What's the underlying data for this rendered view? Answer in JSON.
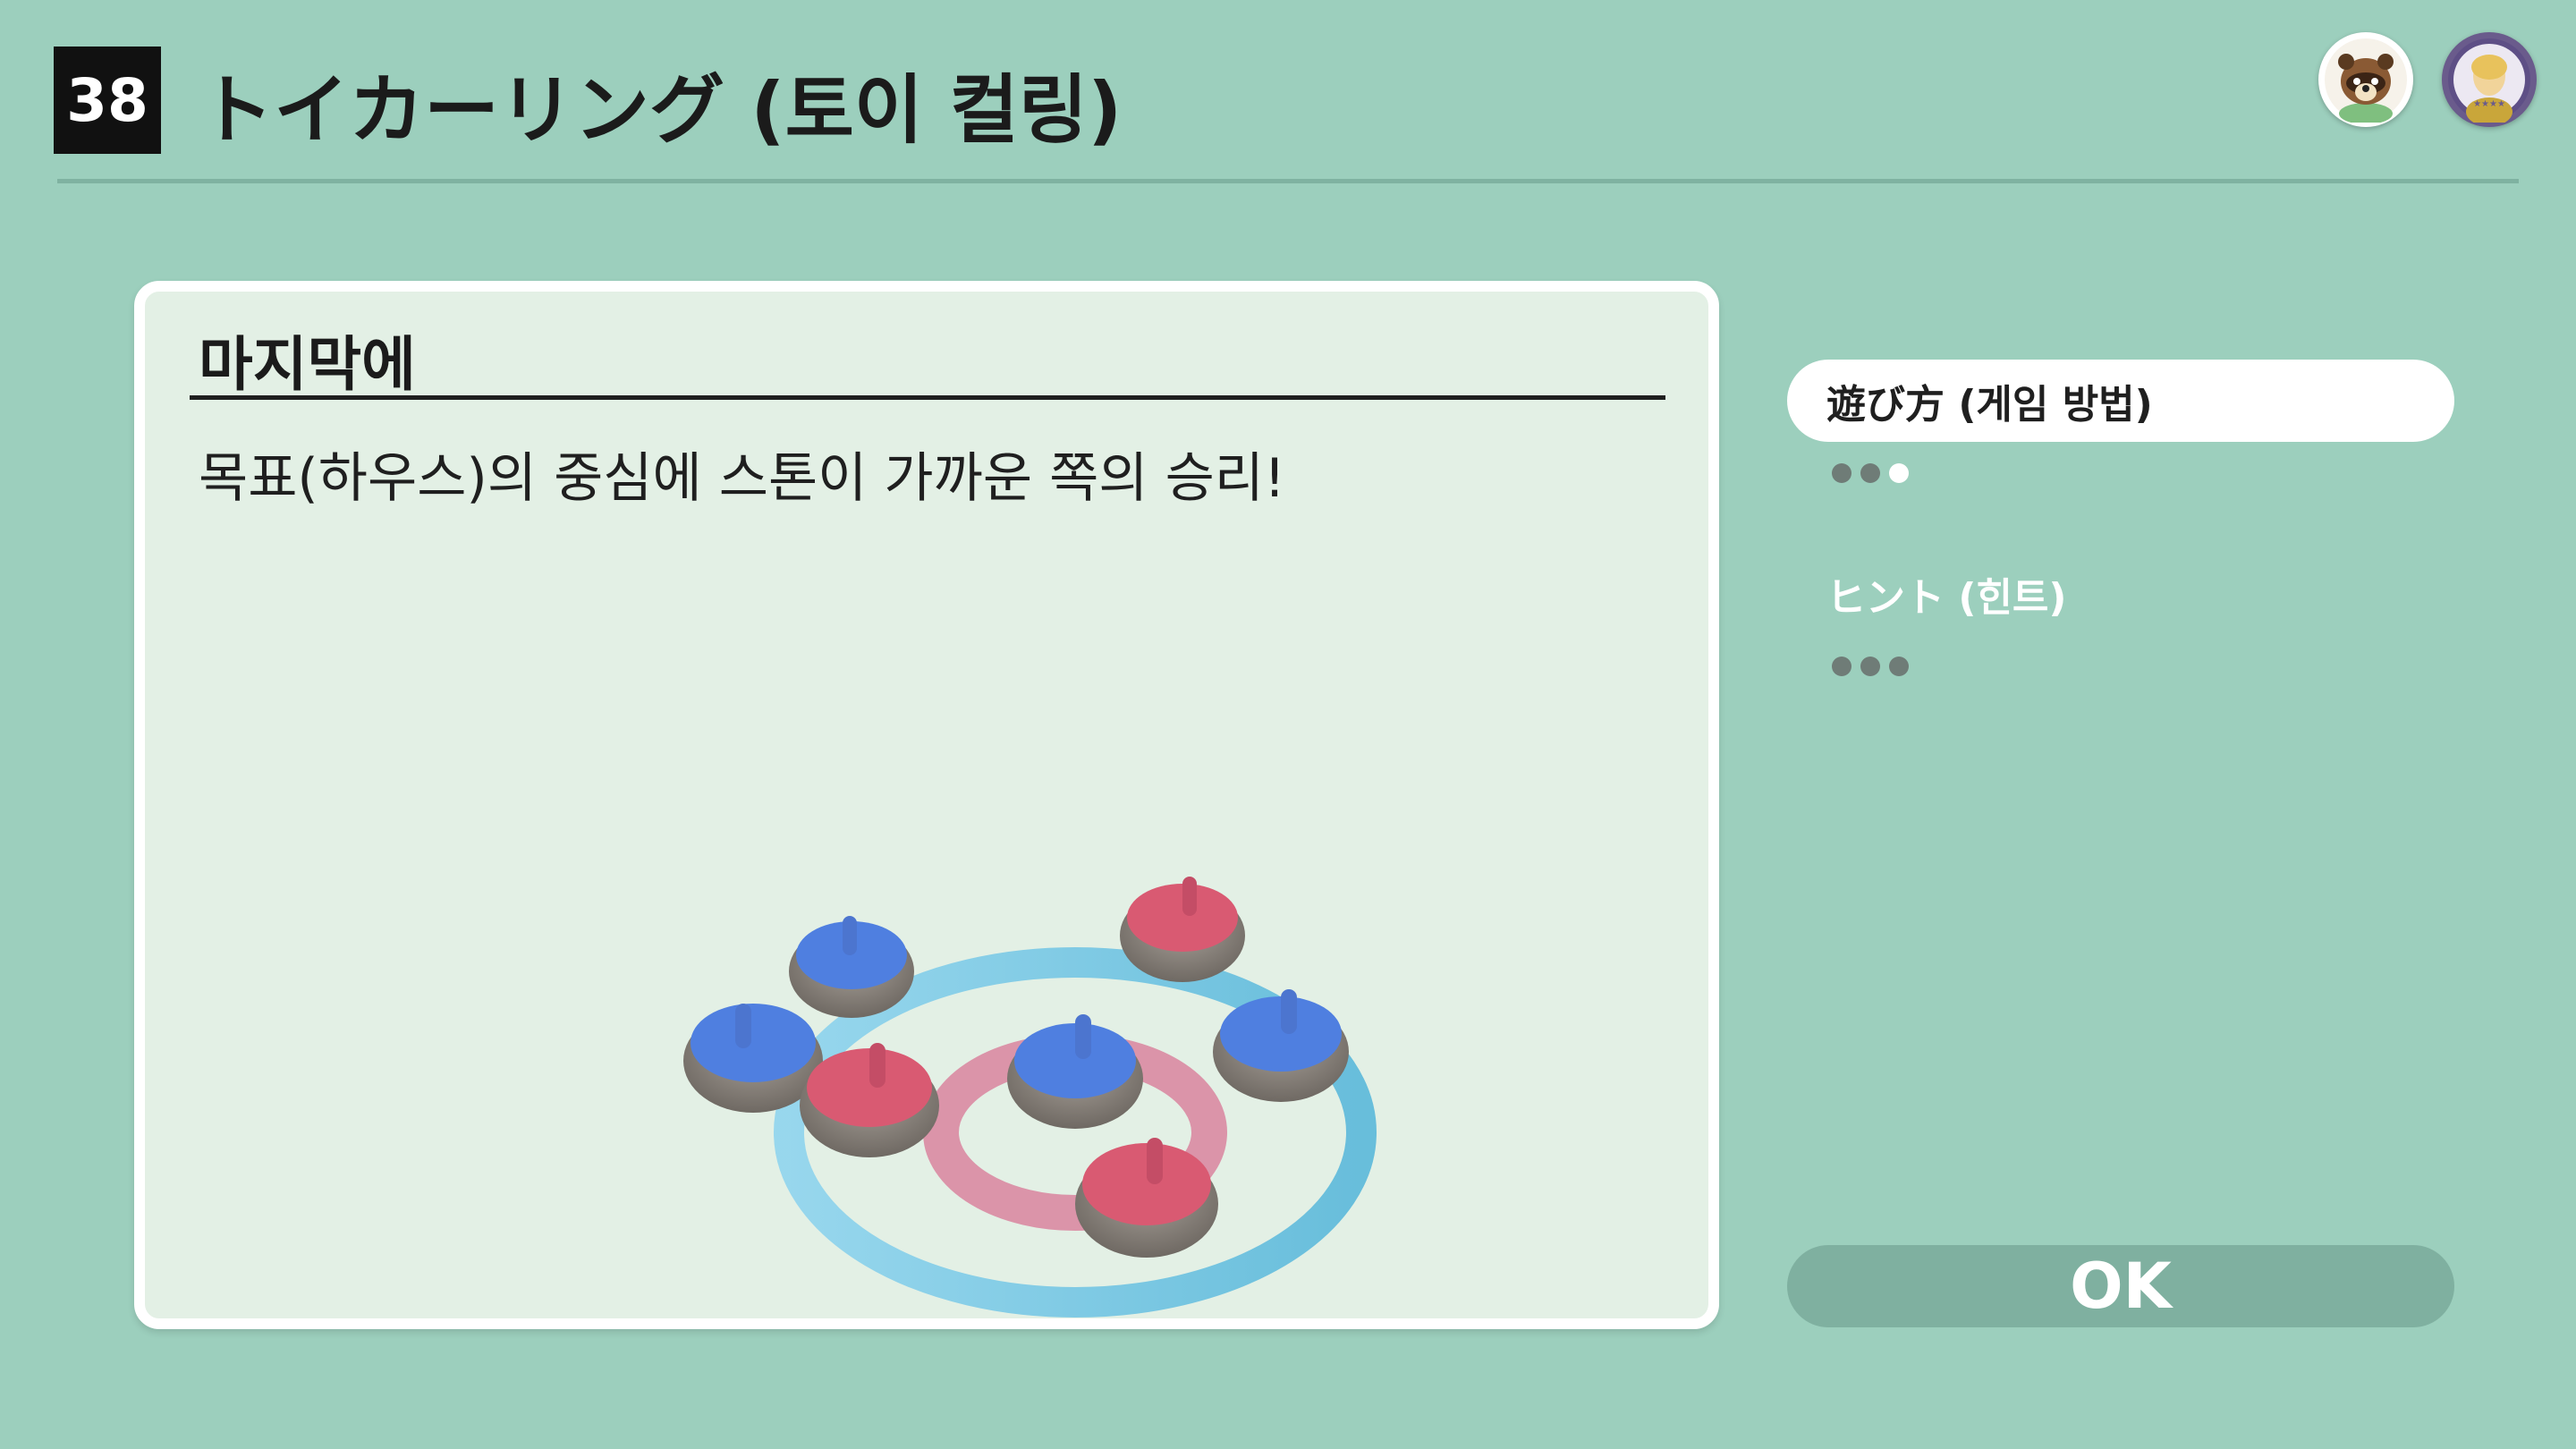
{
  "header": {
    "number": "38",
    "title": "トイカーリング (토이 컬링)"
  },
  "avatars": [
    {
      "icon": "tom-nook-avatar-icon"
    },
    {
      "icon": "player-avatar-icon"
    }
  ],
  "panel": {
    "heading": "마지막에",
    "text": "목표(하우스)의 중심에 스톤이 가까운 쪽의 승리!"
  },
  "menu": {
    "how_to_play": "遊び方 (게임 방법)",
    "hint": "ヒント (힌트)"
  },
  "ok_label": "OK",
  "colors": {
    "background": "#9ccfbd",
    "panel": "#e3f0e5",
    "blue_stone": "#4f7fe0",
    "red_stone": "#d95a72"
  }
}
